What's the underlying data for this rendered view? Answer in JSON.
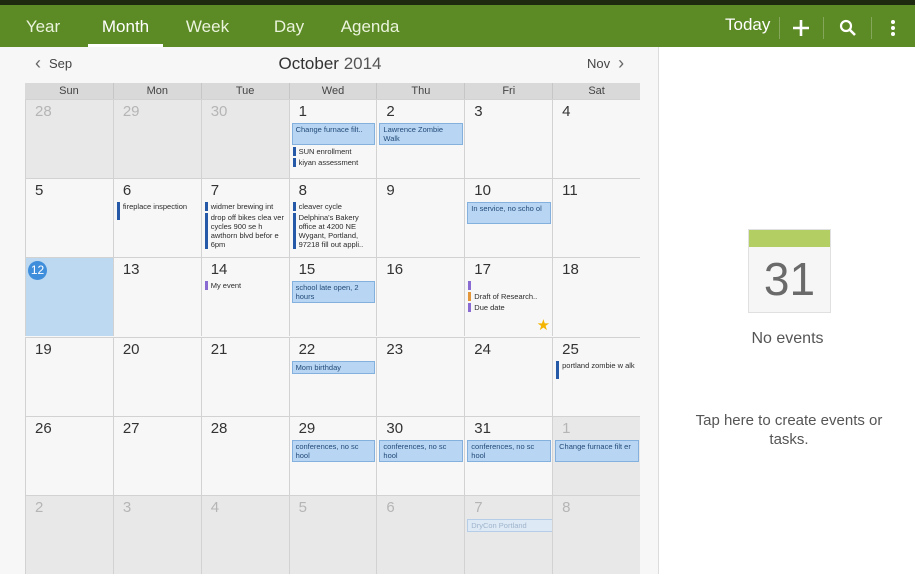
{
  "topbar": {
    "tabs": [
      {
        "label": "Year",
        "active": false
      },
      {
        "label": "Month",
        "active": true
      },
      {
        "label": "Week",
        "active": false
      },
      {
        "label": "Day",
        "active": false
      },
      {
        "label": "Agenda",
        "active": false
      }
    ],
    "today_label": "Today",
    "icons": [
      "add-icon",
      "search-icon",
      "more-vert-icon"
    ],
    "color": "#5c8a24"
  },
  "nav": {
    "prev_label": "Sep",
    "next_label": "Nov",
    "month": "October",
    "year": "2014"
  },
  "days_of_week": [
    "Sun",
    "Mon",
    "Tue",
    "Wed",
    "Thu",
    "Fri",
    "Sat"
  ],
  "weeks": [
    [
      {
        "day": "28",
        "other": true,
        "events": []
      },
      {
        "day": "29",
        "other": true,
        "events": []
      },
      {
        "day": "30",
        "other": true,
        "events": []
      },
      {
        "day": "1",
        "events": [
          {
            "text": "Change furnace filt..",
            "style": "box"
          },
          {
            "text": "SUN enrollment",
            "style": "bar"
          },
          {
            "text": "kiyan assessment",
            "style": "bar"
          }
        ]
      },
      {
        "day": "2",
        "events": [
          {
            "text": "Lawrence Zombie Walk",
            "style": "box"
          }
        ]
      },
      {
        "day": "3",
        "events": []
      },
      {
        "day": "4",
        "events": []
      }
    ],
    [
      {
        "day": "5",
        "events": []
      },
      {
        "day": "6",
        "events": [
          {
            "text": "fireplace inspection",
            "style": "bar"
          }
        ]
      },
      {
        "day": "7",
        "events": [
          {
            "text": "widmer brewing int",
            "style": "bar"
          },
          {
            "text": "drop off bikes clea ver cycles 900 se h awthorn blvd befor e 6pm",
            "style": "bar"
          }
        ]
      },
      {
        "day": "8",
        "events": [
          {
            "text": "cleaver cycle",
            "style": "bar"
          },
          {
            "text": "Delphina's Bakery office at 4200 NE Wygant, Portland, 97218 fill out appli..",
            "style": "bar"
          }
        ]
      },
      {
        "day": "9",
        "events": []
      },
      {
        "day": "10",
        "events": [
          {
            "text": "In service, no scho ol",
            "style": "box"
          }
        ]
      },
      {
        "day": "11",
        "events": []
      }
    ],
    [
      {
        "day": "12",
        "today": true,
        "events": []
      },
      {
        "day": "13",
        "events": []
      },
      {
        "day": "14",
        "events": [
          {
            "text": "My event",
            "style": "bar purple"
          }
        ]
      },
      {
        "day": "15",
        "events": [
          {
            "text": "school late open, 2 hours",
            "style": "box"
          }
        ]
      },
      {
        "day": "16",
        "events": []
      },
      {
        "day": "17",
        "star": true,
        "events": [
          {
            "text": "",
            "style": "bar purple"
          },
          {
            "text": "Draft of Research..",
            "style": "bar orange"
          },
          {
            "text": "Due date",
            "style": "bar purple"
          }
        ]
      },
      {
        "day": "18",
        "events": []
      }
    ],
    [
      {
        "day": "19",
        "events": []
      },
      {
        "day": "20",
        "events": []
      },
      {
        "day": "21",
        "events": []
      },
      {
        "day": "22",
        "events": [
          {
            "text": "Mom birthday",
            "style": "box"
          }
        ]
      },
      {
        "day": "23",
        "events": []
      },
      {
        "day": "24",
        "events": []
      },
      {
        "day": "25",
        "events": [
          {
            "text": "portland zombie w alk",
            "style": "bar"
          }
        ]
      }
    ],
    [
      {
        "day": "26",
        "events": []
      },
      {
        "day": "27",
        "events": []
      },
      {
        "day": "28",
        "events": []
      },
      {
        "day": "29",
        "events": [
          {
            "text": "conferences, no sc hool",
            "style": "box"
          }
        ]
      },
      {
        "day": "30",
        "events": [
          {
            "text": "conferences, no sc hool",
            "style": "box"
          }
        ]
      },
      {
        "day": "31",
        "events": [
          {
            "text": "conferences, no sc hool",
            "style": "box"
          }
        ]
      },
      {
        "day": "1",
        "other": true,
        "events": [
          {
            "text": "Change furnace filt er",
            "style": "box"
          }
        ]
      }
    ],
    [
      {
        "day": "2",
        "other": true,
        "events": []
      },
      {
        "day": "3",
        "other": true,
        "events": []
      },
      {
        "day": "4",
        "other": true,
        "events": []
      },
      {
        "day": "5",
        "other": true,
        "events": []
      },
      {
        "day": "6",
        "other": true,
        "events": []
      },
      {
        "day": "7",
        "other": true,
        "events": [
          {
            "text": "DryCon Portland",
            "style": "box faint",
            "span": 2
          }
        ]
      },
      {
        "day": "8",
        "other": true,
        "events": []
      }
    ]
  ],
  "detail": {
    "icon_number": "31",
    "no_events": "No events",
    "hint": "Tap here to create events or tasks."
  }
}
